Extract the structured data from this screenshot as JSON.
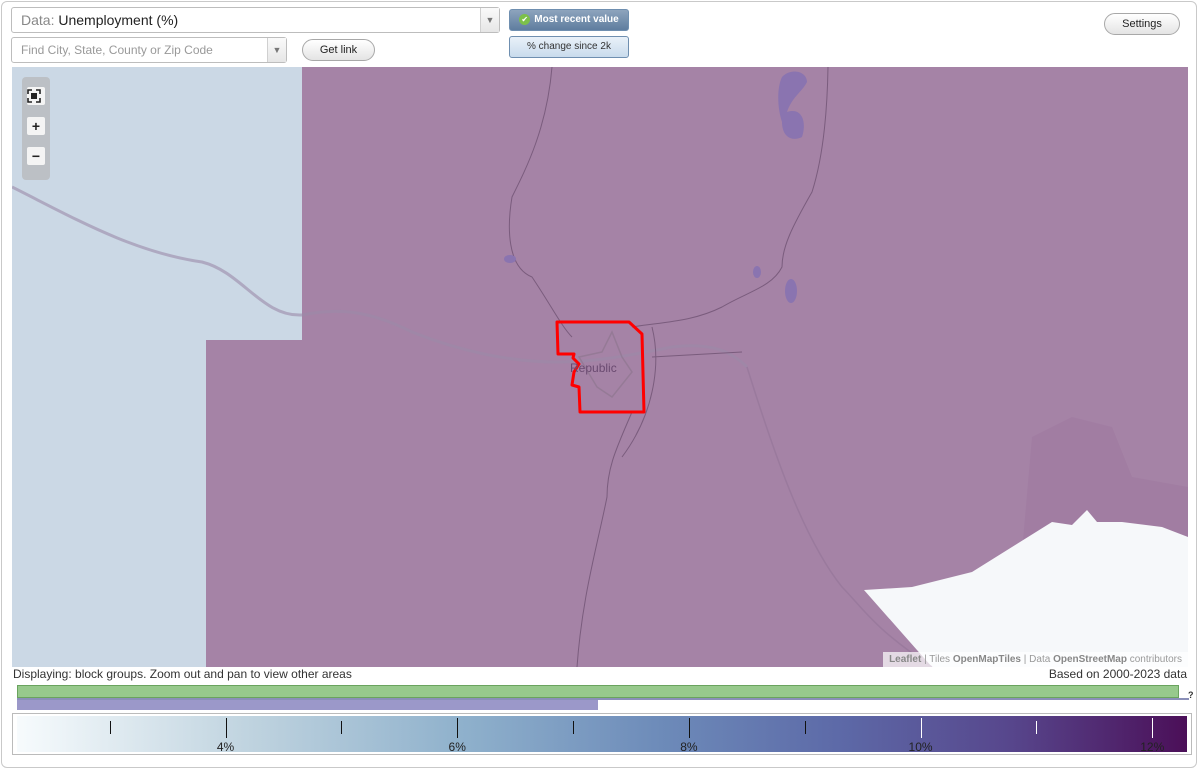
{
  "data_selector": {
    "prefix": "Data:",
    "value": "Unemployment (%)"
  },
  "search": {
    "placeholder": "Find City, State, County or Zip Code"
  },
  "buttons": {
    "get_link": "Get link",
    "settings": "Settings",
    "most_recent": "Most recent value",
    "pct_change": "% change since 2k"
  },
  "icons": {
    "check": "check-icon",
    "fullscreen": "fullscreen-icon",
    "zoom_in": "plus-icon",
    "zoom_out": "minus-icon",
    "dropdown": "chevron-down-icon"
  },
  "map": {
    "place_label": "Republic",
    "attribution": {
      "leaflet": "Leaflet",
      "tiles_label": "Tiles",
      "tiles_source": "OpenMapTiles",
      "data_label": "Data",
      "data_source": "OpenStreetMap",
      "contributors": "contributors"
    }
  },
  "status": {
    "displaying": "Displaying: block groups. Zoom out and pan to view other areas",
    "based_on": "Based on 2000-2023 data",
    "unknown_marker": "?"
  },
  "range_bars": {
    "green_fraction": 1.0,
    "blue_fraction": 0.5
  },
  "legend": {
    "min": 2.2,
    "max": 12.3,
    "ticks": [
      3,
      4,
      5,
      6,
      7,
      8,
      9,
      10,
      11,
      12
    ],
    "labels": [
      {
        "value": 4,
        "text": "4%"
      },
      {
        "value": 6,
        "text": "6%"
      },
      {
        "value": 8,
        "text": "8%"
      },
      {
        "value": 10,
        "text": "10%"
      },
      {
        "value": 12,
        "text": "12%"
      }
    ]
  },
  "colors": {
    "choropleth": "#a583a6",
    "water": "#cbd8e5",
    "highlight": "#ff0000",
    "lake": "#8a74b0",
    "green_bar": "#97c98c",
    "blue_bar": "#9b98c9"
  }
}
